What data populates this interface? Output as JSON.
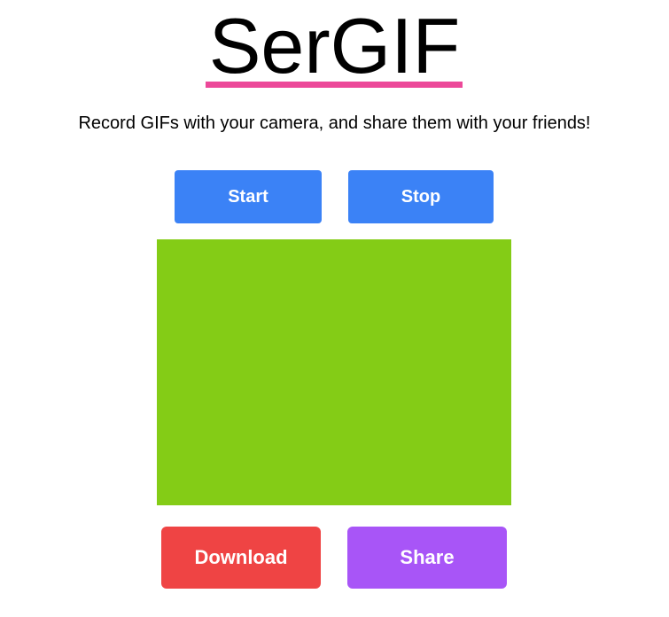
{
  "header": {
    "title": "SerGIF",
    "underline_color": "#EC4899",
    "tagline": "Record GIFs with your camera, and share them with your friends!"
  },
  "controls": {
    "start_label": "Start",
    "stop_label": "Stop",
    "button_color": "#3B82F6"
  },
  "preview": {
    "color": "#84CC16"
  },
  "actions": {
    "download_label": "Download",
    "download_color": "#EF4444",
    "share_label": "Share",
    "share_color": "#A855F7"
  }
}
